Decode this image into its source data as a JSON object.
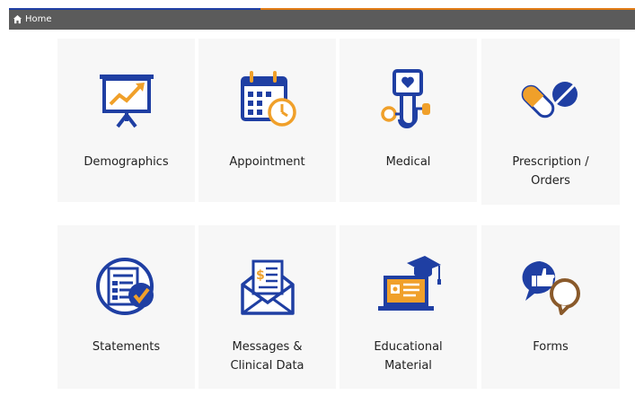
{
  "topbar": {
    "home_label": "Home",
    "accent_left": "#1f3fa3",
    "accent_right": "#e07b15"
  },
  "tiles": [
    {
      "label": "Demographics",
      "icon": "presentation-chart-icon"
    },
    {
      "label": "Appointment",
      "icon": "calendar-clock-icon"
    },
    {
      "label": "Medical",
      "icon": "blood-pressure-monitor-icon"
    },
    {
      "label": "Prescription / Orders",
      "label_lines": [
        "Prescription /",
        "Orders"
      ],
      "icon": "pills-icon"
    },
    {
      "label": "Statements",
      "icon": "document-checkmark-icon"
    },
    {
      "label": "Messages & Clinical Data",
      "label_lines": [
        "Messages &",
        "Clinical Data"
      ],
      "icon": "envelope-letter-icon"
    },
    {
      "label": "Educational Material",
      "label_lines": [
        "Educational",
        "Material"
      ],
      "icon": "laptop-graduation-cap-icon"
    },
    {
      "label": "Forms",
      "icon": "thumbs-up-speech-bubble-icon"
    }
  ],
  "colors": {
    "blue": "#1f3fa3",
    "orange": "#f0a02a",
    "tile_bg": "#f7f7f7",
    "bar_bg": "#5b5b5b"
  }
}
